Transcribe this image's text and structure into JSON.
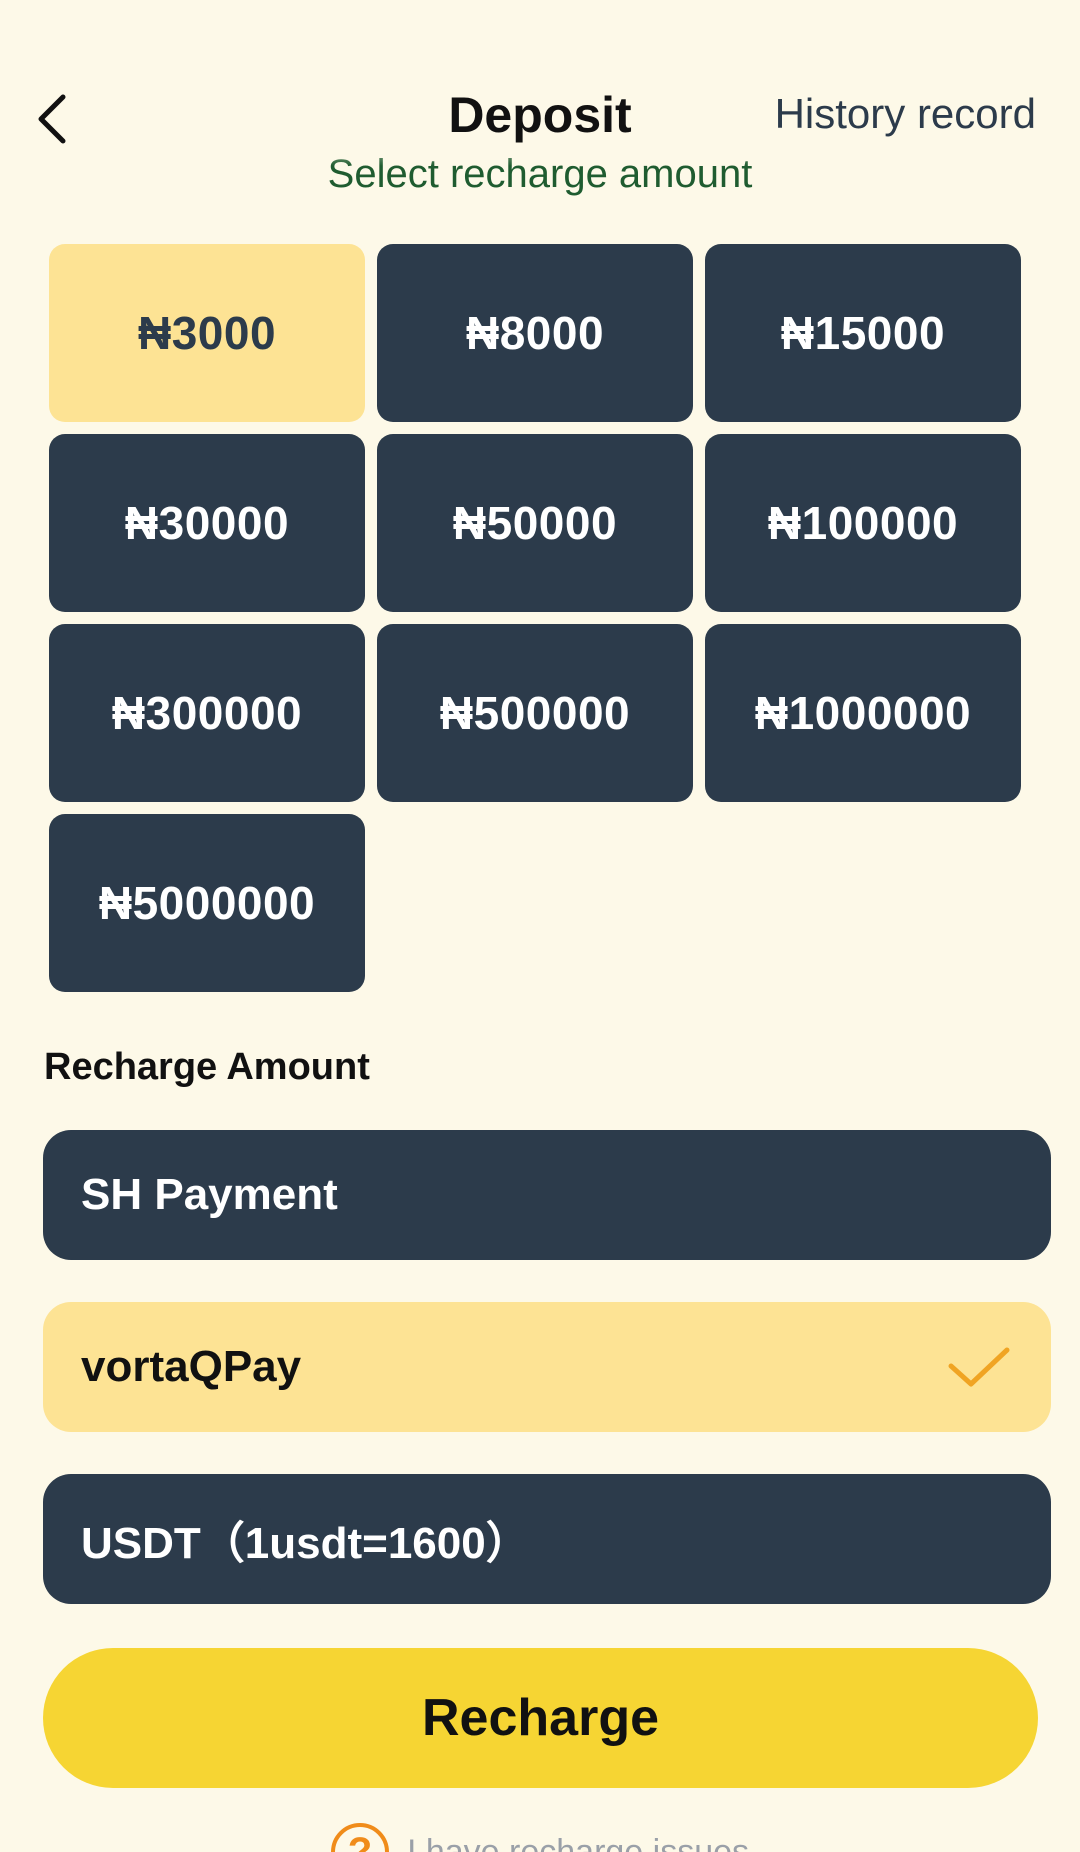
{
  "header": {
    "title": "Deposit",
    "history_label": "History record"
  },
  "amount_section": {
    "subtitle": "Select recharge amount",
    "amounts": [
      "₦3000",
      "₦8000",
      "₦15000",
      "₦30000",
      "₦50000",
      "₦100000",
      "₦300000",
      "₦500000",
      "₦1000000",
      "₦5000000"
    ],
    "selected": "₦3000"
  },
  "recharge_amount_label": "Recharge Amount",
  "payment_methods": [
    {
      "label": "SH Payment",
      "selected": false
    },
    {
      "label": "vortaQPay",
      "selected": true
    },
    {
      "label": "USDT（1usdt=1600）",
      "selected": false
    }
  ],
  "recharge_button_label": "Recharge",
  "issues_link": "I have recharge issues",
  "colors": {
    "background": "#fdf9e8",
    "tile_dark": "#2c3b4b",
    "tile_selected": "#fde394",
    "primary_button": "#f6d533",
    "check_mark": "#f0a423",
    "help_icon": "#f08c1a"
  },
  "icons": {
    "back": "chevron-left-icon",
    "selected": "checkmark-icon",
    "help": "question-circle-icon"
  }
}
